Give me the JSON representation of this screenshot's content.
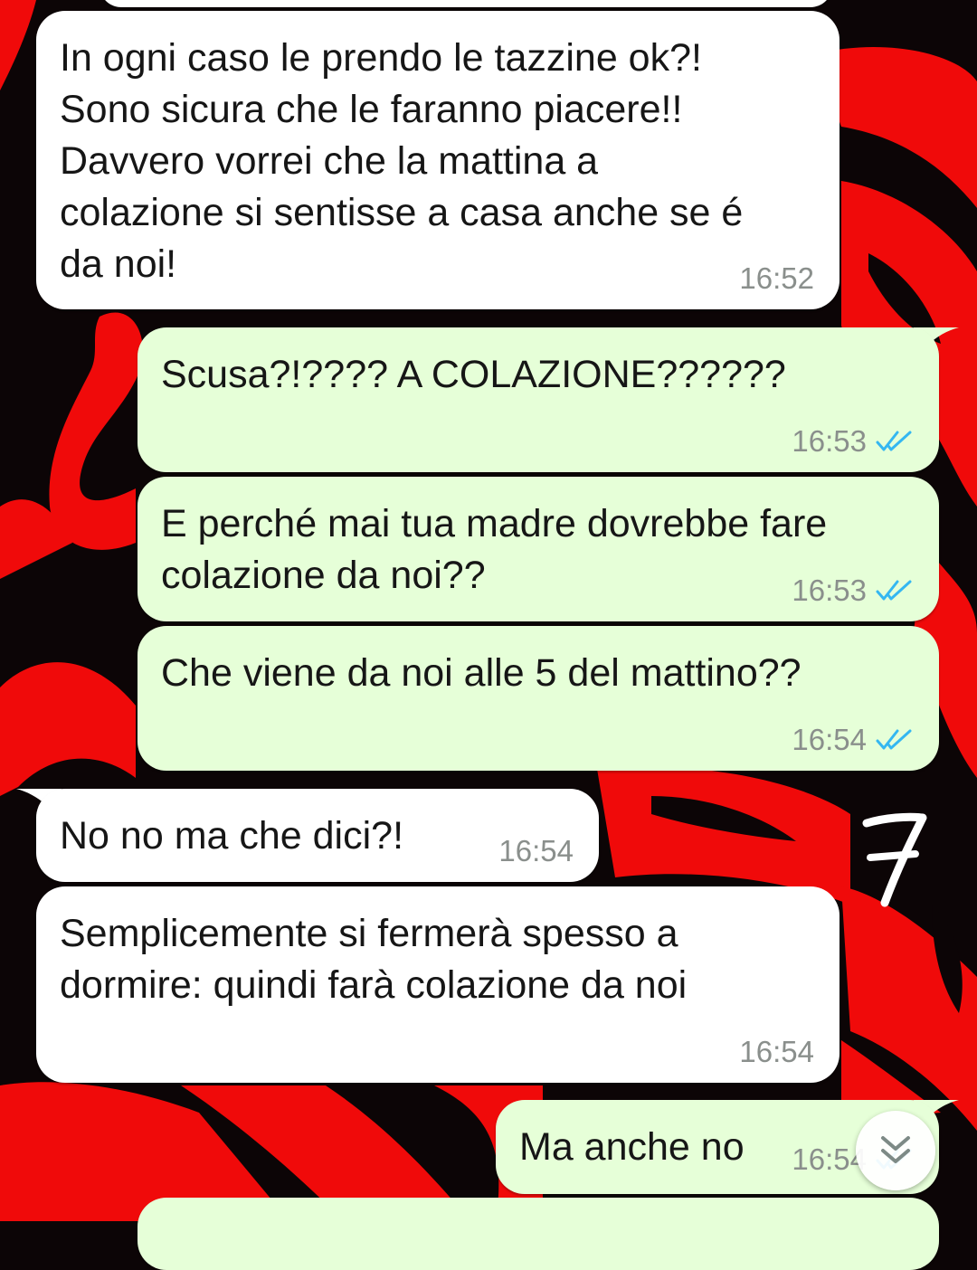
{
  "theme": {
    "incoming_bubble": "#ffffff",
    "outgoing_bubble": "#e6ffd8",
    "wallpaper_red": "#f00a0a",
    "wallpaper_dark": "#0c0506",
    "read_tick_color": "#34b7f1"
  },
  "messages": [
    {
      "direction": "incoming",
      "text": "In ogni caso le prendo le tazzine ok?!\nSono sicura che le faranno piacere!!\nDavvero vorrei che la mattina a\ncolazione si sentisse a casa anche se é\nda noi!",
      "time": "16:52"
    },
    {
      "direction": "outgoing",
      "text": "Scusa?!???? A COLAZIONE??????",
      "time": "16:53",
      "status": "read"
    },
    {
      "direction": "outgoing",
      "text": "E perché mai tua madre dovrebbe fare\ncolazione da noi??",
      "time": "16:53",
      "status": "read"
    },
    {
      "direction": "outgoing",
      "text": "Che viene da noi alle 5 del mattino??",
      "time": "16:54",
      "status": "read"
    },
    {
      "direction": "incoming",
      "text": "No no ma che dici?!",
      "time": "16:54"
    },
    {
      "direction": "incoming",
      "text": "Semplicemente si fermerà spesso a\ndormire: quindi farà colazione da noi",
      "time": "16:54"
    },
    {
      "direction": "outgoing",
      "text": "Ma anche no",
      "time": "16:54",
      "status": "read"
    }
  ],
  "overlay": {
    "page_number": "7",
    "page_number_icon": "handwritten-number"
  },
  "controls": {
    "scroll_down_icon": "double-chevron-down-icon"
  }
}
